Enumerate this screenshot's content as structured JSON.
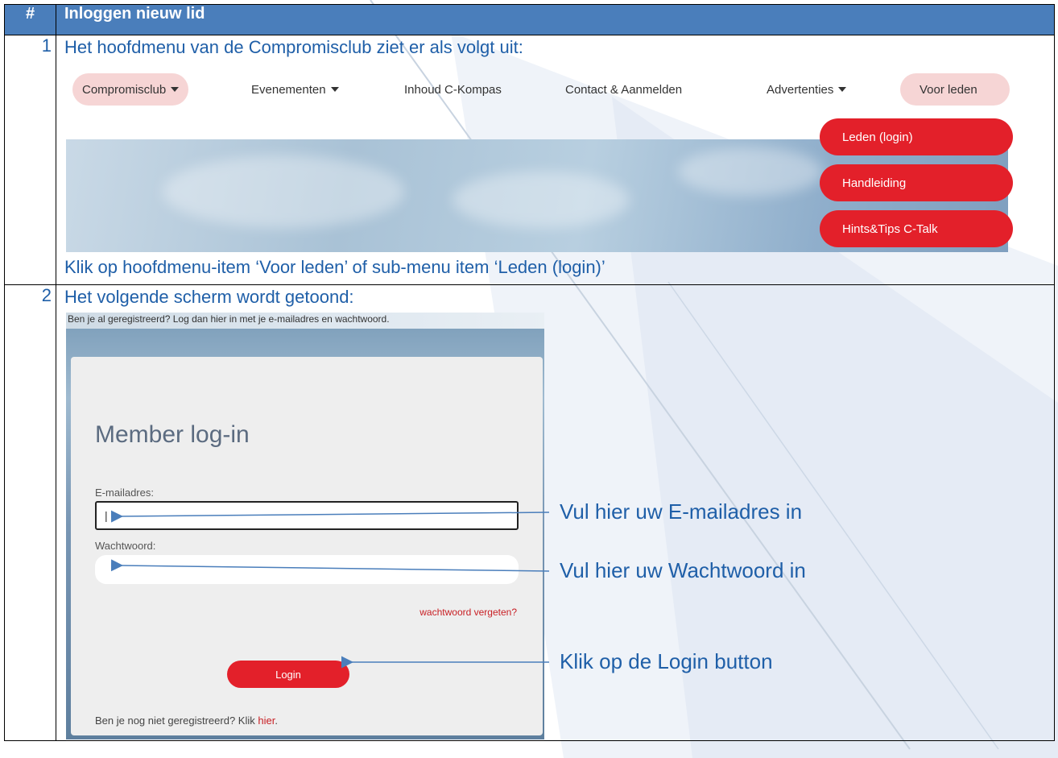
{
  "table": {
    "header_num": "#",
    "header_title": "Inloggen nieuw lid"
  },
  "step1": {
    "number": "1",
    "intro": "Het hoofdmenu van de Compromisclub ziet er als volgt uit:",
    "menu": [
      {
        "label": "Compromisclub",
        "dropdown": true,
        "active": true
      },
      {
        "label": "Evenementen",
        "dropdown": true,
        "active": false
      },
      {
        "label": "Inhoud C-Kompas",
        "dropdown": false,
        "active": false
      },
      {
        "label": "Contact & Aanmelden",
        "dropdown": false,
        "active": false
      },
      {
        "label": "Advertenties",
        "dropdown": true,
        "active": false
      },
      {
        "label": "Voor leden",
        "dropdown": false,
        "active": true
      }
    ],
    "submenu": [
      "Leden (login)",
      "Handleiding",
      "Hints&Tips C-Talk"
    ],
    "caption": "Klik op hoofdmenu-item ‘Voor leden’ of sub-menu item ‘Leden (login)’"
  },
  "step2": {
    "number": "2",
    "intro": "Het volgende scherm wordt getoond:",
    "login": {
      "top_text": "Ben je al geregistreerd? Log dan hier in met je e-mailadres en wachtwoord.",
      "title": "Member log-in",
      "email_label": "E-mailadres:",
      "email_value": "|",
      "password_label": "Wachtwoord:",
      "password_value": "",
      "forgot": "wachtwoord vergeten?",
      "button": "Login",
      "register_prefix": "Ben je nog niet geregistreerd? Klik ",
      "register_link": "hier",
      "register_suffix": "."
    },
    "annotations": {
      "email": "Vul hier uw E-mailadres in",
      "password": "Vul hier uw Wachtwoord in",
      "button": "Klik op de Login button"
    }
  },
  "colors": {
    "header_blue": "#4a7ebb",
    "text_blue": "#1f5fa8",
    "accent_red": "#e3202a",
    "menu_active_pink": "#f6d5d5"
  }
}
